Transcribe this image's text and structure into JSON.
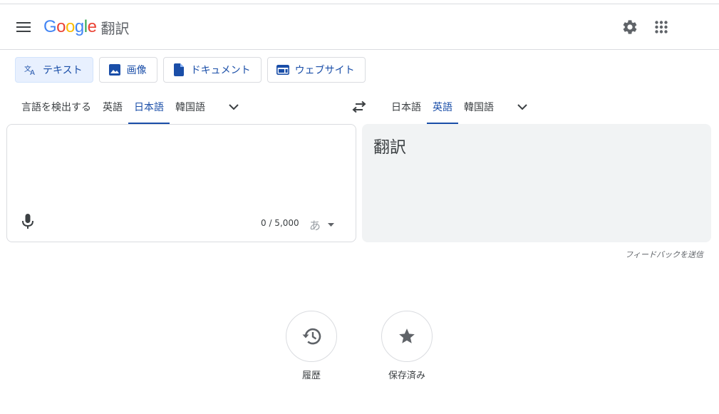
{
  "header": {
    "logo_text": "Google",
    "product_name": "翻訳",
    "menu_icon": "hamburger-menu-icon",
    "settings_icon": "gear-icon",
    "apps_icon": "apps-grid-icon"
  },
  "mode_tabs": [
    {
      "label": "テキスト",
      "icon": "translate-icon",
      "active": true
    },
    {
      "label": "画像",
      "icon": "image-icon",
      "active": false
    },
    {
      "label": "ドキュメント",
      "icon": "document-icon",
      "active": false
    },
    {
      "label": "ウェブサイト",
      "icon": "website-icon",
      "active": false
    }
  ],
  "source_langs": [
    "言語を検出する",
    "英語",
    "日本語",
    "韓国語"
  ],
  "source_selected": "日本語",
  "target_langs": [
    "日本語",
    "英語",
    "韓国語"
  ],
  "target_selected": "英語",
  "source": {
    "value": "",
    "char_count": "0 / 5,000",
    "ime_label": "あ"
  },
  "target": {
    "placeholder_text": "翻訳"
  },
  "feedback_label": "フィードバックを送信",
  "quick_actions": {
    "history_label": "履歴",
    "saved_label": "保存済み"
  },
  "colors": {
    "accent": "#1a4ea8",
    "google_blue": "#4285f4",
    "google_red": "#ea4335",
    "google_yellow": "#fbbc05",
    "google_green": "#34a853"
  }
}
